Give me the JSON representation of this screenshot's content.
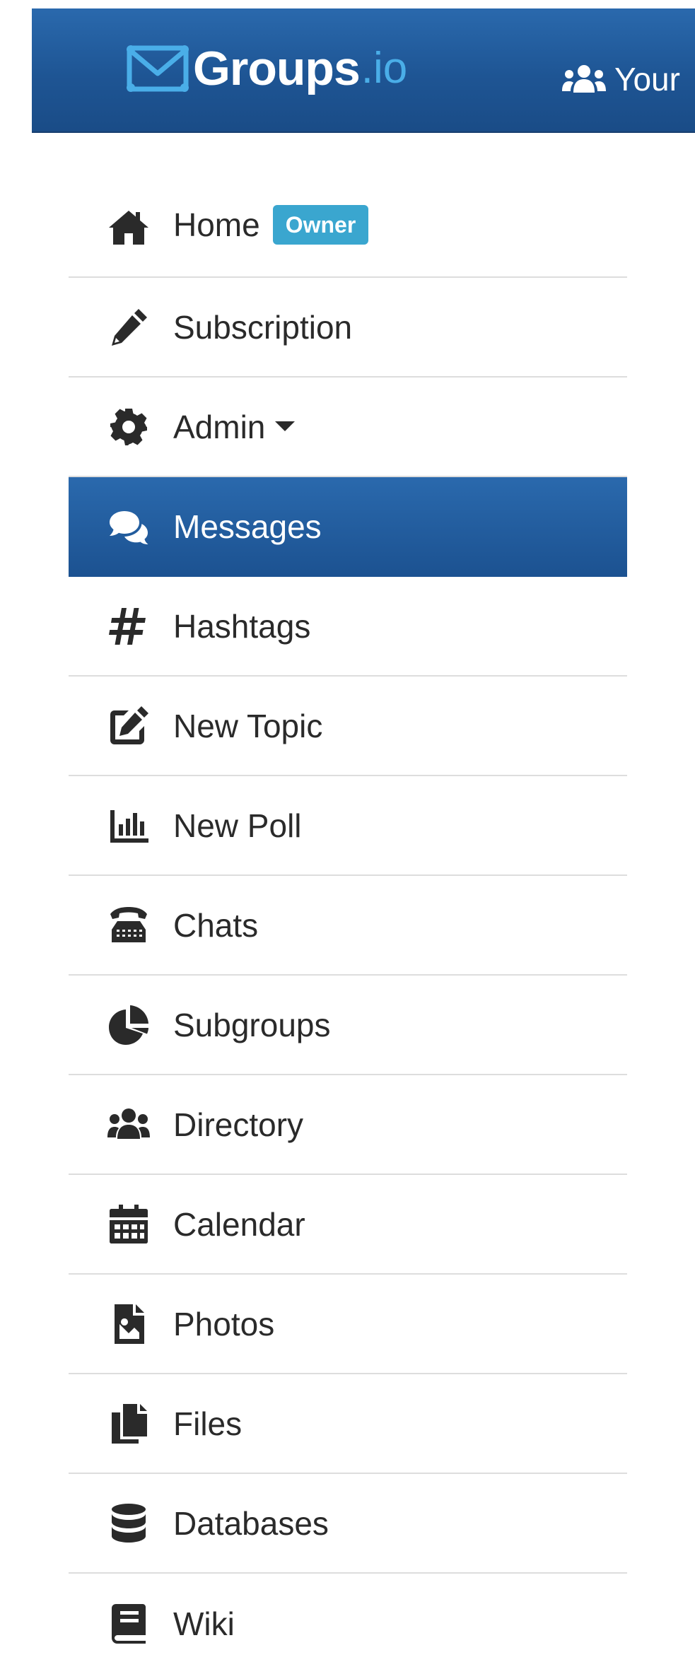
{
  "navbar": {
    "brand_name": "Groups",
    "brand_suffix": ".io",
    "your_groups_label": "Your",
    "colors": {
      "background": "#1e5594",
      "brand_suffix": "#4aaee8"
    }
  },
  "menu": {
    "active_color": "#1e5594",
    "badge_color": "#3aa6cf",
    "items": [
      {
        "label": "Home",
        "badge": "Owner",
        "icon": "home-icon"
      },
      {
        "label": "Subscription",
        "icon": "pencil-icon"
      },
      {
        "label": "Admin",
        "icon": "gear-icon",
        "dropdown": true
      },
      {
        "label": "Messages",
        "icon": "comments-icon",
        "active": true
      },
      {
        "label": "Hashtags",
        "icon": "hashtag-icon"
      },
      {
        "label": "New Topic",
        "icon": "edit-icon"
      },
      {
        "label": "New Poll",
        "icon": "bar-chart-icon"
      },
      {
        "label": "Chats",
        "icon": "phone-icon"
      },
      {
        "label": "Subgroups",
        "icon": "pie-chart-icon"
      },
      {
        "label": "Directory",
        "icon": "users-icon"
      },
      {
        "label": "Calendar",
        "icon": "calendar-icon"
      },
      {
        "label": "Photos",
        "icon": "image-file-icon"
      },
      {
        "label": "Files",
        "icon": "files-icon"
      },
      {
        "label": "Databases",
        "icon": "database-icon"
      },
      {
        "label": "Wiki",
        "icon": "book-icon"
      }
    ]
  }
}
